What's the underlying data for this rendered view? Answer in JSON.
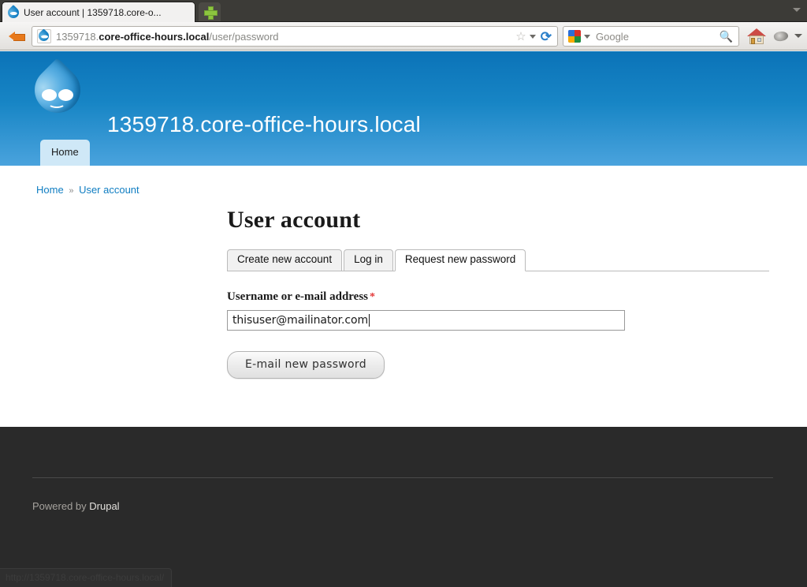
{
  "browser": {
    "tab": {
      "title": "User account | 1359718.core-o...",
      "favicon": "drupal-droplet-icon"
    },
    "new_tab_label": "+",
    "toolbar": {
      "back_icon": "back-arrow-icon",
      "url_prefix": "1359718.",
      "url_host": "core-office-hours.local",
      "url_path": "/user/password",
      "star_icon": "☆",
      "reload_icon": "⟳",
      "home_icon": "home-icon",
      "extension_icon": "extension-icon",
      "overflow_icon": "chevron-down-icon"
    },
    "search": {
      "engine": "Google",
      "placeholder": "Google",
      "magnifier_icon": "search-icon"
    },
    "statusbar": {
      "url": "http://1359718.core-office-hours.local/"
    }
  },
  "site": {
    "name": "1359718.core-office-hours.local",
    "logo": "drupal-droplet-logo",
    "menu": [
      {
        "label": "Home",
        "active": true
      }
    ],
    "colors": {
      "header_top": "#0b73b8",
      "header_bottom": "#4aa3dd",
      "link": "#0f7dc2",
      "required": "#e33a3a",
      "footer_bg": "#2a2a2a"
    }
  },
  "breadcrumb": {
    "items": [
      {
        "label": "Home"
      },
      {
        "label": "User account"
      }
    ],
    "separator": "»"
  },
  "main": {
    "title": "User account",
    "tabs": [
      {
        "label": "Create new account",
        "active": false
      },
      {
        "label": "Log in",
        "active": false
      },
      {
        "label": "Request new password",
        "active": true
      }
    ],
    "form": {
      "label": "Username or e-mail address",
      "required_marker": "*",
      "value": "thisuser@mailinator.com",
      "placeholder": "",
      "submit_label": "E-mail new password"
    }
  },
  "footer": {
    "prefix": "Powered by ",
    "link_label": "Drupal"
  }
}
